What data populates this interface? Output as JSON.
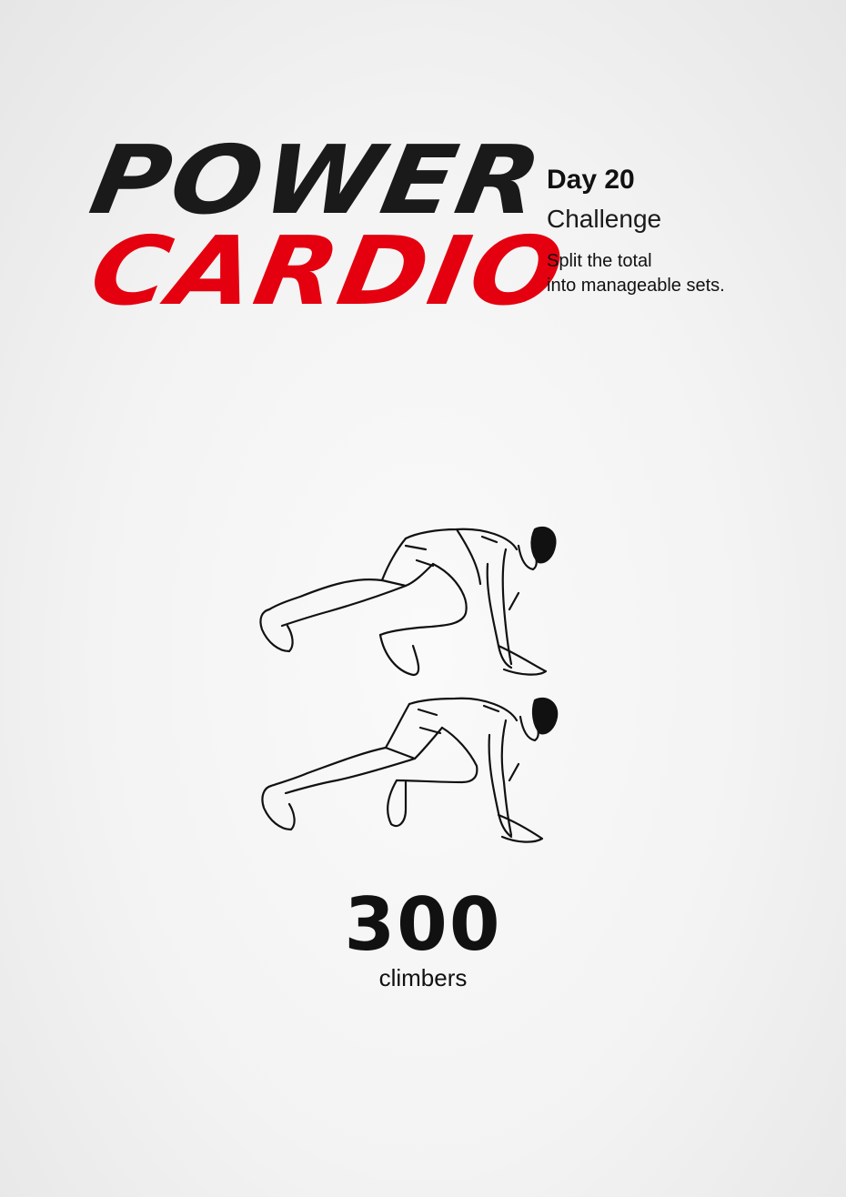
{
  "logo": {
    "line1": "POWER",
    "line2": "CARDIO"
  },
  "info": {
    "day": "Day 20",
    "type": "Challenge",
    "hint_line1": "Split the total",
    "hint_line2": "into manageable sets."
  },
  "exercise": {
    "count": "300",
    "unit": "climbers",
    "illustration": "mountain-climber-figure-icon"
  },
  "colors": {
    "brand_red": "#e4000f",
    "text_dark": "#1a1a1a"
  }
}
